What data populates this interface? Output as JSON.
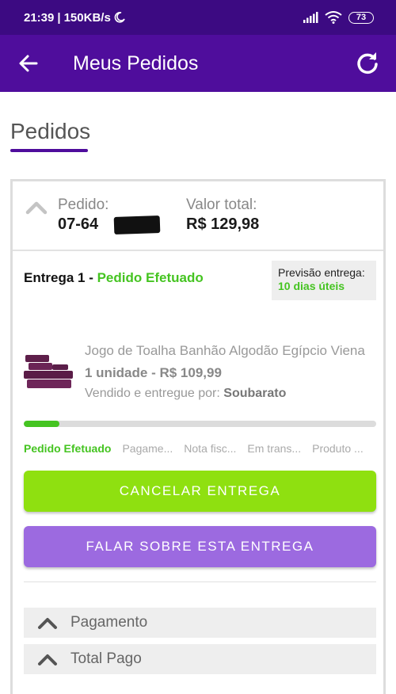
{
  "status_bar": {
    "time": "21:39",
    "separator": "|",
    "speed": "150KB/s",
    "battery": "73"
  },
  "app_bar": {
    "title": "Meus Pedidos"
  },
  "section": {
    "title": "Pedidos"
  },
  "order": {
    "number_label": "Pedido:",
    "number_value": "07-64",
    "total_label": "Valor total:",
    "total_value": "R$ 129,98"
  },
  "delivery": {
    "title": "Entrega 1 -",
    "status": "Pedido Efetuado",
    "forecast_label": "Previsão entrega:",
    "forecast_value": "10 dias úteis"
  },
  "product": {
    "name": "Jogo de Toalha Banhão Algodão Egípcio Viena",
    "quantity_price": "1 unidade - R$ 109,99",
    "seller_label": "Vendido e entregue por:",
    "seller_name": "Soubarato"
  },
  "progress": {
    "fraction": 0.1
  },
  "steps": [
    "Pedido Efetuado",
    "Pagame...",
    "Nota fisc...",
    "Em trans...",
    "Produto ..."
  ],
  "buttons": {
    "cancel": "CANCELAR ENTREGA",
    "talk": "FALAR SOBRE ESTA ENTREGA"
  },
  "sections": {
    "payment": "Pagamento",
    "total_paid": "Total Pago"
  },
  "colors": {
    "brand_purple": "#4f0d9c",
    "accent_green": "#45c421",
    "cancel_green": "#8fe010",
    "talk_purple": "#9c6ae0"
  }
}
